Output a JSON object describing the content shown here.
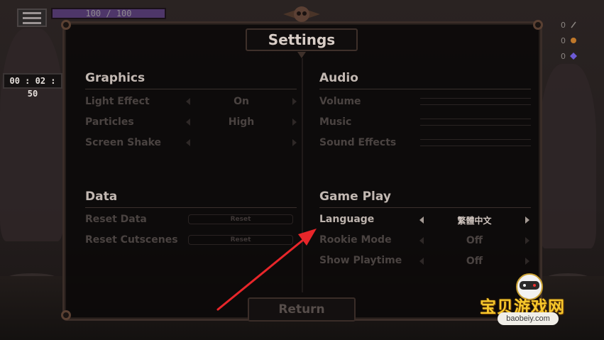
{
  "hud": {
    "hp_text": "100 / 100",
    "hp_fraction": 1.0,
    "timer": "00 : 02 : 50",
    "counters": [
      {
        "value": "0",
        "icon": "feather-icon",
        "color": "#8a8480"
      },
      {
        "value": "0",
        "icon": "coin-icon",
        "color": "#c0782a"
      },
      {
        "value": "0",
        "icon": "gem-icon",
        "color": "#6d5bd6"
      }
    ]
  },
  "dialog": {
    "title": "Settings",
    "return_label": "Return"
  },
  "graphics": {
    "title": "Graphics",
    "rows": [
      {
        "label": "Light Effect",
        "value": "On"
      },
      {
        "label": "Particles",
        "value": "High"
      },
      {
        "label": "Screen Shake",
        "value": ""
      }
    ]
  },
  "audio": {
    "title": "Audio",
    "rows": [
      {
        "label": "Volume"
      },
      {
        "label": "Music"
      },
      {
        "label": "Sound Effects"
      }
    ]
  },
  "data": {
    "title": "Data",
    "rows": [
      {
        "label": "Reset Data",
        "button": "Reset"
      },
      {
        "label": "Reset Cutscenes",
        "button": "Reset"
      }
    ]
  },
  "gameplay": {
    "title": "Game Play",
    "rows": [
      {
        "label": "Language",
        "value": "繁體中文"
      },
      {
        "label": "Rookie Mode",
        "value": "Off"
      },
      {
        "label": "Show Playtime",
        "value": "Off"
      }
    ]
  },
  "watermark": {
    "text": "宝贝游戏网",
    "url": "baobeiy.com"
  },
  "colors": {
    "accent_red": "#e8262a",
    "watermark_gold": "#f7c82c"
  }
}
